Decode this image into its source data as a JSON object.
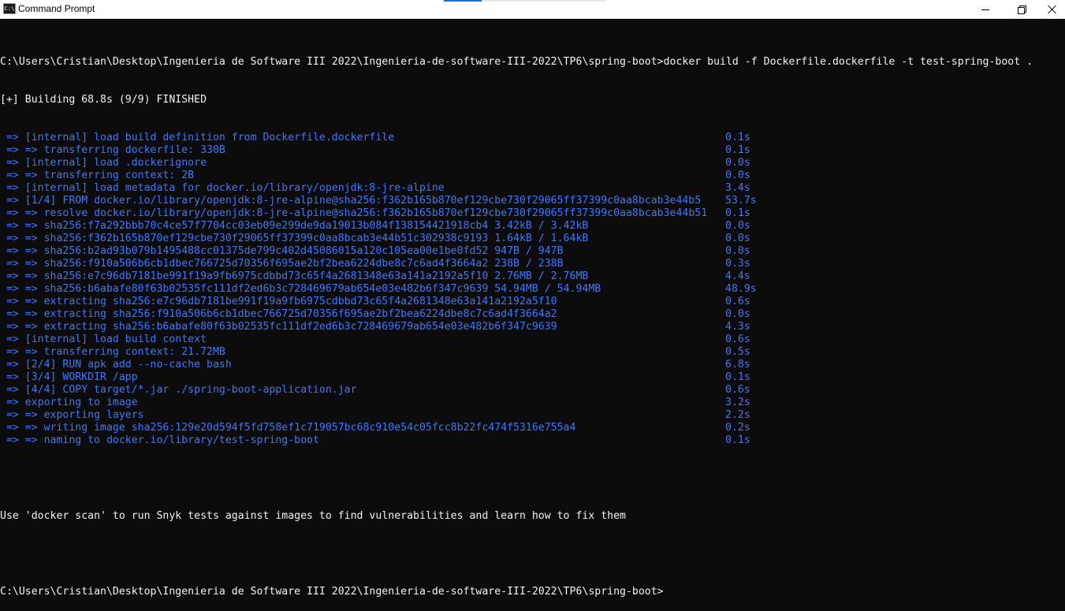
{
  "window": {
    "title": "Command Prompt",
    "icon": "cmd-icon",
    "controls": [
      "minimize-icon",
      "maximize-icon",
      "close-icon"
    ]
  },
  "colors": {
    "background": "#0c0c0c",
    "text": "#f2f2f2",
    "build_step": "#3b78ff",
    "titlebar": "#ffffff",
    "accent": "#1f6fd1"
  },
  "console": {
    "command_line": "C:\\Users\\Cristian\\Desktop\\Ingenieria de Software III 2022\\Ingenieria-de-software-III-2022\\TP6\\spring-boot>docker build -f Dockerfile.dockerfile -t test-spring-boot .",
    "status_line": "[+] Building 68.8s (9/9) FINISHED",
    "steps": [
      {
        "text": " => [internal] load build definition from Dockerfile.dockerfile",
        "time": "0.1s"
      },
      {
        "text": " => => transferring dockerfile: 330B",
        "time": "0.1s"
      },
      {
        "text": " => [internal] load .dockerignore",
        "time": "0.0s"
      },
      {
        "text": " => => transferring context: 2B",
        "time": "0.0s"
      },
      {
        "text": " => [internal] load metadata for docker.io/library/openjdk:8-jre-alpine",
        "time": "3.4s"
      },
      {
        "text": " => [1/4] FROM docker.io/library/openjdk:8-jre-alpine@sha256:f362b165b870ef129cbe730f29065ff37399c0aa8bcab3e44b5",
        "time": "53.7s"
      },
      {
        "text": " => => resolve docker.io/library/openjdk:8-jre-alpine@sha256:f362b165b870ef129cbe730f29065ff37399c0aa8bcab3e44b51",
        "time": "0.1s"
      },
      {
        "text": " => => sha256:f7a292bbb70c4ce57f7704cc03eb09e299de9da19013b084f138154421918cb4 3.42kB / 3.42kB",
        "time": "0.0s"
      },
      {
        "text": " => => sha256:f362b165b870ef129cbe730f29065ff37399c0aa8bcab3e44b51c302938c9193 1.64kB / 1.64kB",
        "time": "0.0s"
      },
      {
        "text": " => => sha256:b2ad93b079b1495488cc01375de799c402d45086015a120c105ea00e1be0fd52 947B / 947B",
        "time": "0.0s"
      },
      {
        "text": " => => sha256:f910a506b6cb1dbec766725d70356f695ae2bf2bea6224dbe8c7c6ad4f3664a2 238B / 238B",
        "time": "0.3s"
      },
      {
        "text": " => => sha256:e7c96db7181be991f19a9fb6975cdbbd73c65f4a2681348e63a141a2192a5f10 2.76MB / 2.76MB",
        "time": "4.4s"
      },
      {
        "text": " => => sha256:b6abafe80f63b02535fc111df2ed6b3c728469679ab654e03e482b6f347c9639 54.94MB / 54.94MB",
        "time": "48.9s"
      },
      {
        "text": " => => extracting sha256:e7c96db7181be991f19a9fb6975cdbbd73c65f4a2681348e63a141a2192a5f10",
        "time": "0.6s"
      },
      {
        "text": " => => extracting sha256:f910a506b6cb1dbec766725d70356f695ae2bf2bea6224dbe8c7c6ad4f3664a2",
        "time": "0.0s"
      },
      {
        "text": " => => extracting sha256:b6abafe80f63b02535fc111df2ed6b3c728469679ab654e03e482b6f347c9639",
        "time": "4.3s"
      },
      {
        "text": " => [internal] load build context",
        "time": "0.6s"
      },
      {
        "text": " => => transferring context: 21.72MB",
        "time": "0.5s"
      },
      {
        "text": " => [2/4] RUN apk add --no-cache bash",
        "time": "6.8s"
      },
      {
        "text": " => [3/4] WORKDIR /app",
        "time": "0.1s"
      },
      {
        "text": " => [4/4] COPY target/*.jar ./spring-boot-application.jar",
        "time": "0.6s"
      },
      {
        "text": " => exporting to image",
        "time": "3.2s"
      },
      {
        "text": " => => exporting layers",
        "time": "2.2s"
      },
      {
        "text": " => => writing image sha256:129e20d594f5fd758ef1c719057bc68c910e54c05fcc8b22fc474f5316e755a4",
        "time": "0.2s"
      },
      {
        "text": " => => naming to docker.io/library/test-spring-boot",
        "time": "0.1s"
      }
    ],
    "hint_line": "Use 'docker scan' to run Snyk tests against images to find vulnerabilities and learn how to fix them",
    "prompt_line": "C:\\Users\\Cristian\\Desktop\\Ingenieria de Software III 2022\\Ingenieria-de-software-III-2022\\TP6\\spring-boot>"
  }
}
